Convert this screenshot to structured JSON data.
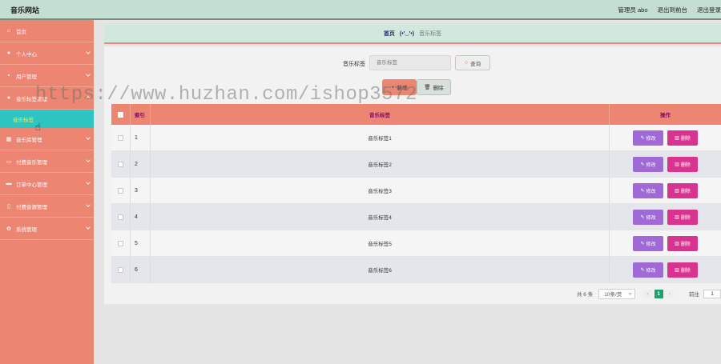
{
  "header": {
    "site_title": "音乐网站",
    "admin_label": "管理员 abo",
    "front_link": "退出到前台",
    "logout_link": "退出登录"
  },
  "sidebar": {
    "items": [
      {
        "label": "首页",
        "icon": "home-icon",
        "glyph": "⌂"
      },
      {
        "label": "个人中心",
        "icon": "user-icon",
        "glyph": "●"
      },
      {
        "label": "用户管理",
        "icon": "users-icon",
        "glyph": "▪"
      },
      {
        "label": "音乐标签管理",
        "icon": "tag-user-icon",
        "glyph": "●"
      },
      {
        "label": "音乐库管理",
        "icon": "grid-icon",
        "glyph": "▦"
      },
      {
        "label": "付费音乐管理",
        "icon": "ticket-icon",
        "glyph": "▭"
      },
      {
        "label": "订单中心管理",
        "icon": "chat-icon",
        "glyph": "▬"
      },
      {
        "label": "付费音源管理",
        "icon": "mic-icon",
        "glyph": "▯"
      },
      {
        "label": "系统管理",
        "icon": "settings-icon",
        "glyph": "✿"
      }
    ],
    "active_submenu": "音乐标签"
  },
  "breadcrumb": {
    "home": "首页",
    "emoji": "(•'◡'•)",
    "current": "音乐标签"
  },
  "search": {
    "label": "音乐标签",
    "placeholder": "音乐标签",
    "query_button": "查询",
    "query_icon": "search-icon"
  },
  "actions": {
    "add_label": "新增",
    "delete_label": "删除"
  },
  "table": {
    "headers": {
      "index": "索引",
      "tag": "音乐标签",
      "ops": "操作"
    },
    "rows": [
      {
        "index": "1",
        "tag": "音乐标签1"
      },
      {
        "index": "2",
        "tag": "音乐标签2"
      },
      {
        "index": "3",
        "tag": "音乐标签3"
      },
      {
        "index": "4",
        "tag": "音乐标签4"
      },
      {
        "index": "5",
        "tag": "音乐标签5"
      },
      {
        "index": "6",
        "tag": "音乐标签6"
      }
    ],
    "edit_label": "修改",
    "row_delete_label": "删除"
  },
  "pagination": {
    "total_text": "共 6 条",
    "page_size": "10条/页",
    "prev": "‹",
    "current_page": "1",
    "next": "›",
    "goto_label": "前往",
    "goto_value": "1"
  },
  "watermark": "https://www.huzhan.com/ishop3572",
  "colors": {
    "sidebar": "#ec8673",
    "active_submenu_bg": "#2cc5bf",
    "active_submenu_text": "#ffe94a",
    "header": "#c4dfd1",
    "edit_button": "#9f6ad6",
    "delete_button": "#d7338f",
    "current_page": "#1fa16e"
  }
}
